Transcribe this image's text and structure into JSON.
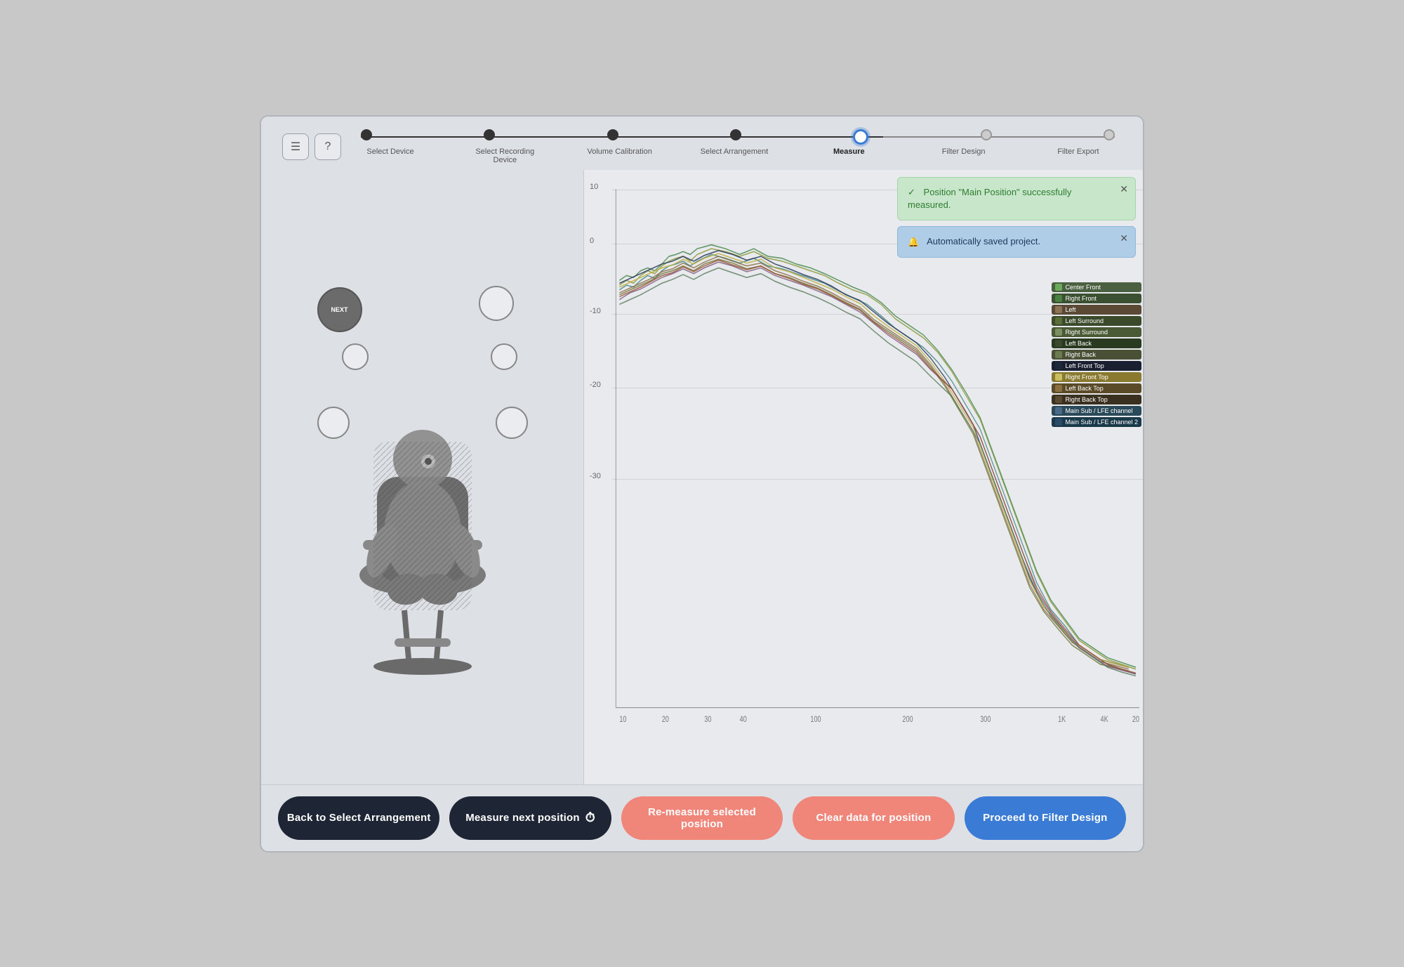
{
  "header": {
    "menu_icon": "☰",
    "help_icon": "?",
    "steps": [
      {
        "label": "Select Device",
        "state": "done"
      },
      {
        "label": "Select Recording Device",
        "state": "done"
      },
      {
        "label": "Volume Calibration",
        "state": "done"
      },
      {
        "label": "Select Arrangement",
        "state": "done"
      },
      {
        "label": "Measure",
        "state": "active"
      },
      {
        "label": "Filter Design",
        "state": "inactive"
      },
      {
        "label": "Filter Export",
        "state": "inactive"
      }
    ]
  },
  "notifications": [
    {
      "id": "success",
      "type": "success",
      "icon": "✓",
      "text": "Position \"Main Position\" successfully measured."
    },
    {
      "id": "info",
      "type": "info",
      "icon": "🔔",
      "text": "Automatically saved project."
    }
  ],
  "chart": {
    "y_labels": [
      "10",
      "0",
      "-10",
      "-20",
      "-30"
    ],
    "x_labels": [
      "10",
      "20",
      "30",
      "40",
      "100",
      "200",
      "300",
      "1K",
      "4K",
      "20"
    ],
    "legend": [
      {
        "label": "Center Front",
        "color": "#6aaa5a"
      },
      {
        "label": "Right Front",
        "color": "#4a8040"
      },
      {
        "label": "Left",
        "color": "#8b7355"
      },
      {
        "label": "Left Surround",
        "color": "#5a6e3a"
      },
      {
        "label": "Right Surround",
        "color": "#7a9060"
      },
      {
        "label": "Left Back",
        "color": "#3a4a2a"
      },
      {
        "label": "Right Back",
        "color": "#6b7c50"
      },
      {
        "label": "Left Front Top",
        "color": "#1a2a3a"
      },
      {
        "label": "Right Front Top",
        "color": "#c8c060"
      },
      {
        "label": "Left Back Top",
        "color": "#8a7040"
      },
      {
        "label": "Right Back Top",
        "color": "#5a4a30"
      },
      {
        "label": "Main Sub / LFE channel",
        "color": "#4a6a8a"
      },
      {
        "label": "Main Sub / LFE channel 2",
        "color": "#2a4a6a"
      }
    ]
  },
  "buttons": {
    "back": "Back to Select Arrangement",
    "measure_next": "Measure next position",
    "remeasure": "Re-measure selected position",
    "clear": "Clear data for position",
    "proceed": "Proceed to Filter Design"
  },
  "speaker_labels": {
    "next_label": "NEXT"
  }
}
